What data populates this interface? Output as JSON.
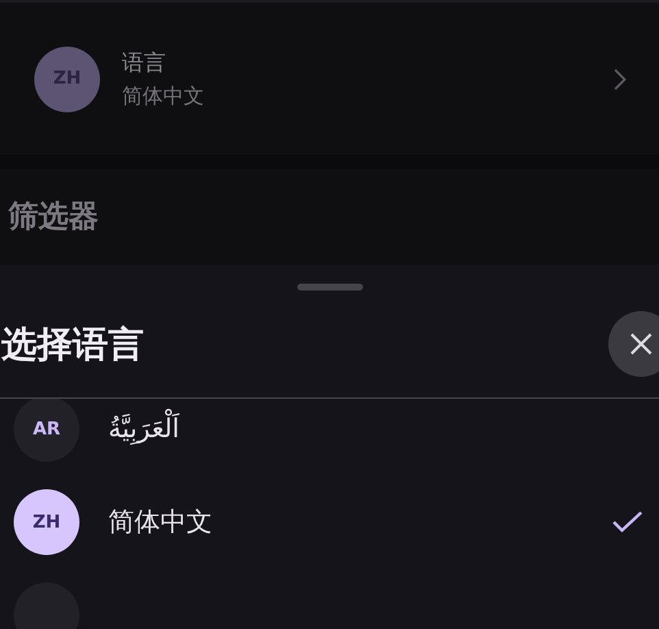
{
  "settings_row": {
    "avatar": "ZH",
    "label": "语言",
    "value": "简体中文"
  },
  "section_title": "筛选器",
  "sheet": {
    "title": "选择语言",
    "languages": [
      {
        "code": "AR",
        "name": "اَلْعَرَبِيَّةُ",
        "selected": false
      },
      {
        "code": "ZH",
        "name": "简体中文",
        "selected": true
      }
    ]
  }
}
